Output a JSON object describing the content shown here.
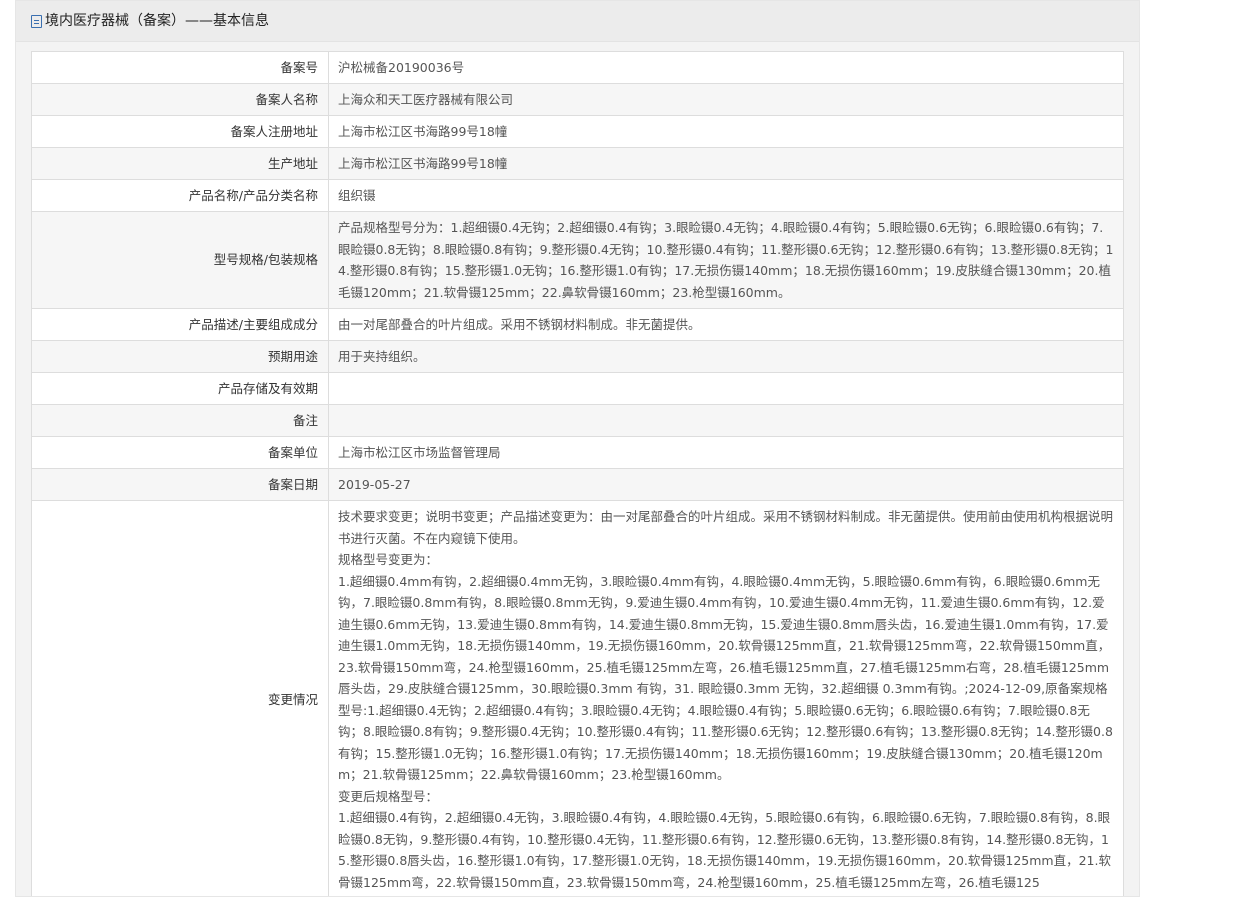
{
  "header": {
    "title": "境内医疗器械（备案）——基本信息",
    "icon": "document-icon",
    "icon_color": "#3a6fb0"
  },
  "rows": [
    {
      "label": "备案号",
      "value": "沪松械备20190036号"
    },
    {
      "label": "备案人名称",
      "value": "上海众和天工医疗器械有限公司"
    },
    {
      "label": "备案人注册地址",
      "value": "上海市松江区书海路99号18幢"
    },
    {
      "label": "生产地址",
      "value": "上海市松江区书海路99号18幢"
    },
    {
      "label": "产品名称/产品分类名称",
      "value": "组织镊"
    },
    {
      "label": "型号规格/包装规格",
      "value": "产品规格型号分为：1.超细镊0.4无钩；2.超细镊0.4有钩；3.眼睑镊0.4无钩；4.眼睑镊0.4有钩；5.眼睑镊0.6无钩；6.眼睑镊0.6有钩；7.眼睑镊0.8无钩；8.眼睑镊0.8有钩；9.整形镊0.4无钩；10.整形镊0.4有钩；11.整形镊0.6无钩；12.整形镊0.6有钩；13.整形镊0.8无钩；14.整形镊0.8有钩；15.整形镊1.0无钩；16.整形镊1.0有钩；17.无损伤镊140mm；18.无损伤镊160mm；19.皮肤缝合镊130mm；20.植毛镊120mm；21.软骨镊125mm；22.鼻软骨镊160mm；23.枪型镊160mm。"
    },
    {
      "label": "产品描述/主要组成成分",
      "value": "由一对尾部叠合的叶片组成。采用不锈钢材料制成。非无菌提供。"
    },
    {
      "label": "预期用途",
      "value": "用于夹持组织。"
    },
    {
      "label": "产品存储及有效期",
      "value": ""
    },
    {
      "label": "备注",
      "value": ""
    },
    {
      "label": "备案单位",
      "value": "上海市松江区市场监督管理局"
    },
    {
      "label": "备案日期",
      "value": "2019-05-27"
    }
  ],
  "changes": {
    "label": "变更情况",
    "paragraphs": [
      "技术要求变更；说明书变更；产品描述变更为：由一对尾部叠合的叶片组成。采用不锈钢材料制成。非无菌提供。使用前由使用机构根据说明书进行灭菌。不在内窥镜下使用。",
      "规格型号变更为：",
      "1.超细镊0.4mm有钩，2.超细镊0.4mm无钩，3.眼睑镊0.4mm有钩，4.眼睑镊0.4mm无钩，5.眼睑镊0.6mm有钩，6.眼睑镊0.6mm无钩，7.眼睑镊0.8mm有钩，8.眼睑镊0.8mm无钩，9.爱迪生镊0.4mm有钩，10.爱迪生镊0.4mm无钩，11.爱迪生镊0.6mm有钩，12.爱迪生镊0.6mm无钩，13.爱迪生镊0.8mm有钩，14.爱迪生镊0.8mm无钩，15.爱迪生镊0.8mm唇头齿，16.爱迪生镊1.0mm有钩，17.爱迪生镊1.0mm无钩，18.无损伤镊140mm，19.无损伤镊160mm，20.软骨镊125mm直，21.软骨镊125mm弯，22.软骨镊150mm直，23.软骨镊150mm弯，24.枪型镊160mm，25.植毛镊125mm左弯，26.植毛镊125mm直，27.植毛镊125mm右弯，28.植毛镊125mm唇头齿，29.皮肤缝合镊125mm，30.眼睑镊0.3mm 有钩，31. 眼睑镊0.3mm 无钩，32.超细镊 0.3mm有钩。;2024-12-09,原备案规格型号:1.超细镊0.4无钩；2.超细镊0.4有钩；3.眼睑镊0.4无钩；4.眼睑镊0.4有钩；5.眼睑镊0.6无钩；6.眼睑镊0.6有钩；7.眼睑镊0.8无钩；8.眼睑镊0.8有钩；9.整形镊0.4无钩；10.整形镊0.4有钩；11.整形镊0.6无钩；12.整形镊0.6有钩；13.整形镊0.8无钩；14.整形镊0.8有钩；15.整形镊1.0无钩；16.整形镊1.0有钩；17.无损伤镊140mm；18.无损伤镊160mm；19.皮肤缝合镊130mm；20.植毛镊120mm；21.软骨镊125mm；22.鼻软骨镊160mm；23.枪型镊160mm。",
      "变更后规格型号：",
      "1.超细镊0.4有钩，2.超细镊0.4无钩，3.眼睑镊0.4有钩，4.眼睑镊0.4无钩，5.眼睑镊0.6有钩，6.眼睑镊0.6无钩，7.眼睑镊0.8有钩，8.眼睑镊0.8无钩，9.整形镊0.4有钩，10.整形镊0.4无钩，11.整形镊0.6有钩，12.整形镊0.6无钩，13.整形镊0.8有钩，14.整形镊0.8无钩，15.整形镊0.8唇头齿，16.整形镊1.0有钩，17.整形镊1.0无钩，18.无损伤镊140mm，19.无损伤镊160mm，20.软骨镊125mm直，21.软骨镊125mm弯，22.软骨镊150mm直，23.软骨镊150mm弯，24.枪型镊160mm，25.植毛镊125mm左弯，26.植毛镊125"
    ]
  }
}
